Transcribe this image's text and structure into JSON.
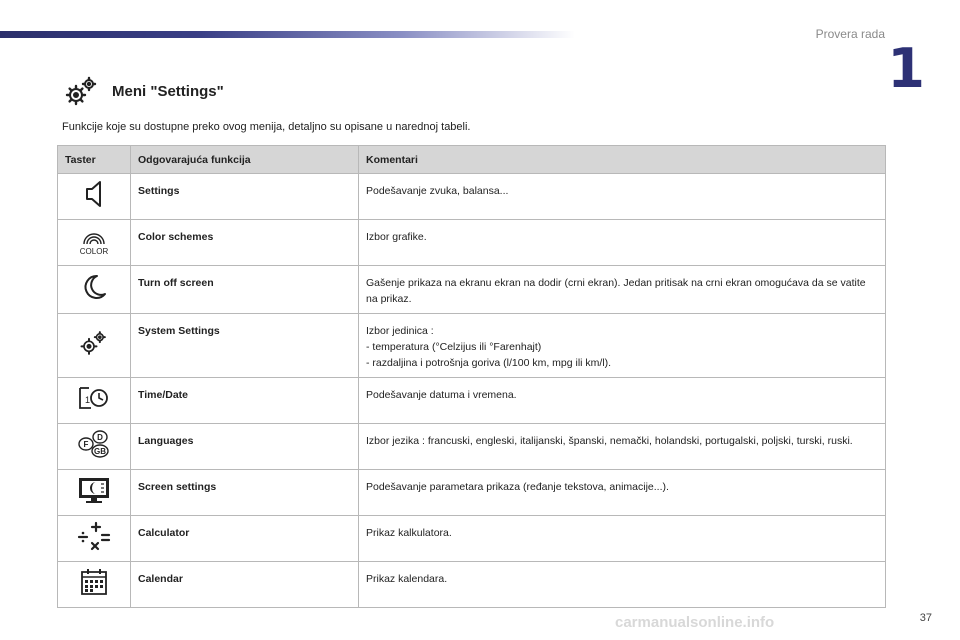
{
  "header": {
    "section_label": "Provera rada",
    "chapter_number": "1"
  },
  "heading": {
    "icon": "gears-icon",
    "title": "Meni \"Settings\""
  },
  "intro": "Funkcije koje su dostupne preko ovog menija, detaljno su opisane u narednoj tabeli.",
  "table": {
    "headers": [
      "Taster",
      "Odgovarajuća funkcija",
      "Komentari"
    ],
    "rows": [
      {
        "icon": "speaker-icon",
        "function": "Settings",
        "comment": [
          "Podešavanje zvuka, balansa..."
        ]
      },
      {
        "icon": "color-rainbow-icon",
        "icon_text": "COLOR",
        "function": "Color schemes",
        "comment": [
          "Izbor grafike."
        ]
      },
      {
        "icon": "moon-icon",
        "function": "Turn off screen",
        "comment": [
          "Gašenje prikaza na ekranu ekran na dodir (crni ekran). Jedan pritisak na crni ekran omogućava da se vatite na prikaz."
        ]
      },
      {
        "icon": "gears-icon",
        "function": "System Settings",
        "comment": [
          "Izbor jedinica :",
          "-   temperatura (°Celzijus ili °Farenhajt)",
          "-   razdaljina i potrošnja goriva (l/100 km, mpg ili km/l)."
        ]
      },
      {
        "icon": "clock-calendar-icon",
        "icon_text": "1",
        "function": "Time/Date",
        "comment": [
          "Podešavanje datuma i vremena."
        ]
      },
      {
        "icon": "languages-icon",
        "icon_letters": [
          "D",
          "F",
          "GB"
        ],
        "function": "Languages",
        "comment": [
          "Izbor jezika : francuski, engleski, italijanski, španski, nemački, holandski, portugalski, poljski, turski, ruski."
        ]
      },
      {
        "icon": "screen-settings-icon",
        "function": "Screen settings",
        "comment": [
          "Podešavanje parametara prikaza (ređanje tekstova, animacije...)."
        ]
      },
      {
        "icon": "calculator-icon",
        "function": "Calculator",
        "comment": [
          "Prikaz kalkulatora."
        ]
      },
      {
        "icon": "calendar-icon",
        "function": "Calendar",
        "comment": [
          "Prikaz kalendara."
        ]
      }
    ]
  },
  "footer": {
    "page_number": "37",
    "watermark": "carmanualsonline.info"
  }
}
